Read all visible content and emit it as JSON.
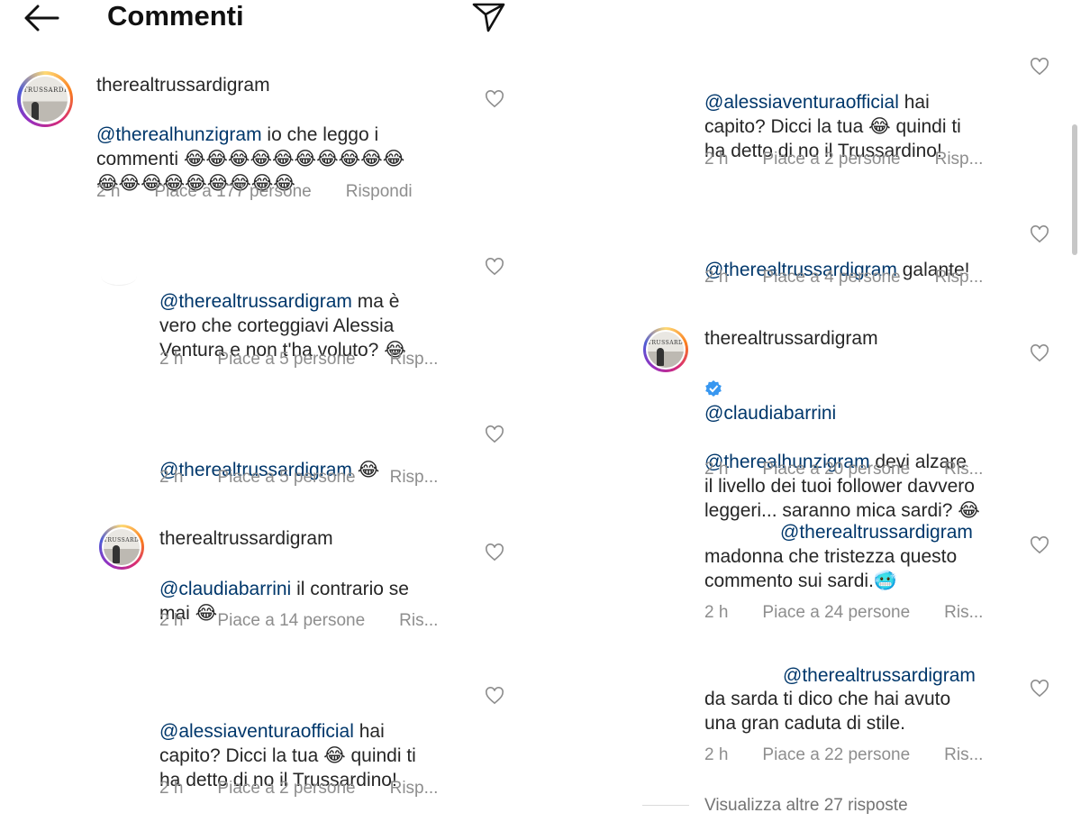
{
  "header": {
    "title": "Commenti"
  },
  "left": {
    "c1": {
      "username": "therealtrussardigram",
      "mention": "@therealhunzigram",
      "text": " io che leggo i\ncommenti 😂😂😂😂😂😂😂😂😂😂\n😂😂😂😂😂😂😂😂😂",
      "time": "2 h",
      "likes": "Piace a 177 persone",
      "reply": "Rispondi"
    },
    "c2": {
      "mention": "@therealtrussardigram",
      "text": " ma è\nvero che corteggiavi Alessia\nVentura e non t'ha voluto? 😂",
      "time": "2 h",
      "likes": "Piace a 5 persone",
      "reply": "Risp..."
    },
    "c3": {
      "mention": "@therealtrussardigram",
      "text": " 😂",
      "time": "2 h",
      "likes": "Piace a 5 persone",
      "reply": "Risp..."
    },
    "c4": {
      "username": "therealtrussardigram",
      "mention": "@claudiabarrini",
      "text": " il contrario se\nmai 😂",
      "time": "2 h",
      "likes": "Piace a 14 persone",
      "reply": "Ris..."
    },
    "c5": {
      "mention": "@alessiaventuraofficial",
      "text": " hai\ncapito? Dicci la tua 😂 quindi ti\nha detto di no il Trussardino!",
      "time": "2 h",
      "likes": "Piace a 2 persone",
      "reply": "Risp..."
    }
  },
  "right": {
    "c1": {
      "mention": "@alessiaventuraofficial",
      "text": " hai\ncapito? Dicci la tua 😂 quindi ti\nha detto di no il Trussardino!",
      "time": "2 h",
      "likes": "Piace a 2 persone",
      "reply": "Risp..."
    },
    "c2": {
      "mention": "@therealtrussardigram",
      "text": " galante!",
      "time": "2 h",
      "likes": "Piace a 4 persone",
      "reply": "Risp..."
    },
    "c3": {
      "username": "therealtrussardigram",
      "mention1": "@claudiabarrini",
      "mention2": "@therealhunzigram",
      "text": " devi alzare\nil livello dei tuoi follower davvero\nleggeri... saranno mica sardi? 😂",
      "time": "2 h",
      "likes": "Piace a 20 persone",
      "reply": "Ris..."
    },
    "c4": {
      "mention": "@therealtrussardigram",
      "text": "madonna che tristezza questo\ncommento sui sardi.🥶",
      "time": "2 h",
      "likes": "Piace a 24 persone",
      "reply": "Ris..."
    },
    "c5": {
      "mention": "@therealtrussardigram",
      "text": "da sarda ti dico che hai avuto\nuna gran caduta di stile.",
      "time": "2 h",
      "likes": "Piace a 22 persone",
      "reply": "Ris..."
    },
    "more_replies": "Visualizza altre 27 risposte"
  },
  "avatar_logo": "TRUSSARDI",
  "colors": {
    "mention": "#00376b",
    "meta": "#8e8e8e",
    "verified": "#3897f0"
  },
  "icons": [
    "back-arrow-icon",
    "send-icon",
    "heart-outline-icon",
    "verified-badge-icon"
  ]
}
